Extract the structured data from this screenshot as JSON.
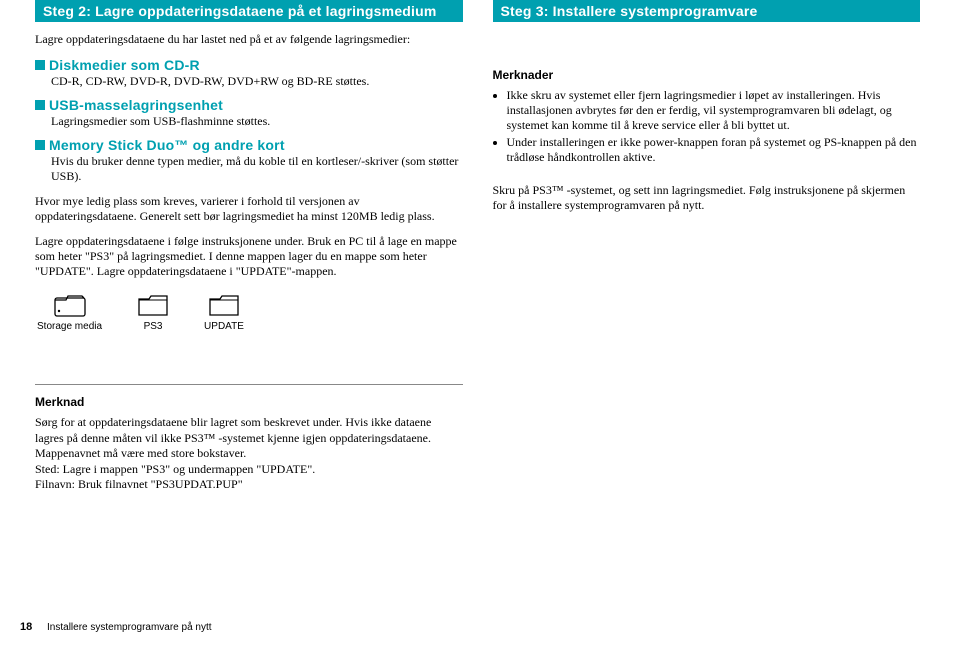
{
  "left": {
    "step_header": "Steg 2: Lagre oppdateringsdataene på et lagringsmedium",
    "intro": "Lagre oppdateringsdataene du har lastet ned på et av følgende lagringsmedier:",
    "items": [
      {
        "head": "Diskmedier som CD-R",
        "desc": "CD-R, CD-RW, DVD-R, DVD-RW, DVD+RW og BD-RE støttes."
      },
      {
        "head": "USB-masselagringsenhet",
        "desc": "Lagringsmedier som USB-flashminne støttes."
      },
      {
        "head": "Memory Stick Duo™ og andre kort",
        "desc": "Hvis du bruker denne typen medier, må du koble til en kortleser/-skriver (som støtter USB)."
      }
    ],
    "para1": "Hvor mye ledig plass som kreves, varierer i forhold til versjonen av oppdateringsdataene. Generelt sett bør lagringsmediet ha minst 120MB ledig plass.",
    "para2": "Lagre oppdateringsdataene i følge instruksjonene under. Bruk en PC til å lage en mappe som heter \"PS3\" på lagringsmediet. I denne mappen lager du en mappe som heter \"UPDATE\". Lagre oppdateringsdataene i \"UPDATE\"-mappen.",
    "folders": [
      "Storage media",
      "PS3",
      "UPDATE"
    ],
    "merknad_head": "Merknad",
    "merknad_body": "Sørg for at oppdateringsdataene blir lagret som beskrevet under. Hvis ikke dataene lagres på denne måten vil ikke PS3™ -systemet kjenne igjen oppdateringsdataene. Mappenavnet må være med store bokstaver.",
    "merknad_line1": "Sted: Lagre i mappen \"PS3\" og undermappen \"UPDATE\".",
    "merknad_line2": "Filnavn: Bruk filnavnet \"PS3UPDAT.PUP\""
  },
  "right": {
    "step_header": "Steg 3: Installere systemprogramvare",
    "merknader_head": "Merknader",
    "bullets": [
      "Ikke skru av systemet eller fjern lagringsmedier i løpet av installeringen. Hvis installasjonen avbrytes før den er ferdig, vil systemprogramvaren bli ødelagt, og systemet kan komme til å kreve service eller å bli byttet ut.",
      "Under installeringen er ikke power-knappen foran på systemet og PS-knappen på den trådløse håndkontrollen aktive."
    ],
    "para": "Skru på PS3™ -systemet, og sett inn lagringsmediet. Følg instruksjonene på skjermen for å installere systemprogramvaren på nytt."
  },
  "footer": {
    "page": "18",
    "title": "Installere systemprogramvare på nytt"
  }
}
